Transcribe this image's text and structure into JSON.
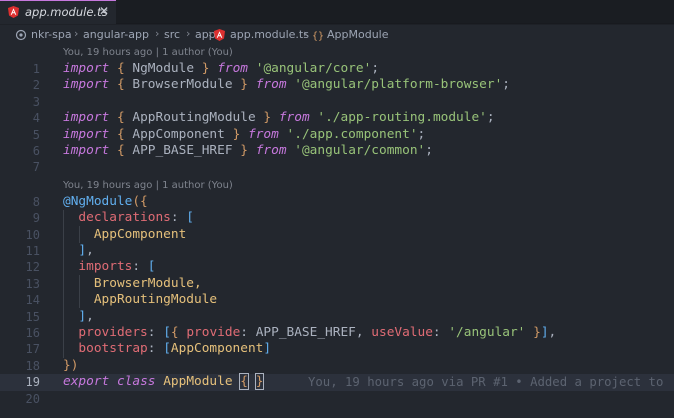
{
  "tab": {
    "filename": "app.module.ts",
    "close": "✕"
  },
  "breadcrumb": {
    "items": [
      "nkr-spa",
      "angular-app",
      "src",
      "app",
      "app.module.ts",
      "AppModule"
    ],
    "separator": "›"
  },
  "blame_annotations": [
    "You, 19 hours ago | 1 author (You)",
    "You, 19 hours ago | 1 author (You)"
  ],
  "line_numbers": [
    "1",
    "2",
    "3",
    "4",
    "5",
    "6",
    "7",
    "8",
    "9",
    "10",
    "11",
    "12",
    "13",
    "14",
    "15",
    "16",
    "17",
    "18",
    "19",
    "20"
  ],
  "code": {
    "l1": {
      "kw": "import",
      "open": "{",
      "name": "NgModule",
      "close": "}",
      "from": "from",
      "str": "'@angular/core'",
      "end": ";"
    },
    "l2": {
      "kw": "import",
      "open": "{",
      "name": "BrowserModule",
      "close": "}",
      "from": "from",
      "str": "'@angular/platform-browser'",
      "end": ";"
    },
    "l4": {
      "kw": "import",
      "open": "{",
      "name": "AppRoutingModule",
      "close": "}",
      "from": "from",
      "str": "'./app-routing.module'",
      "end": ";"
    },
    "l5": {
      "kw": "import",
      "open": "{",
      "name": "AppComponent",
      "close": "}",
      "from": "from",
      "str": "'./app.component'",
      "end": ";"
    },
    "l6": {
      "kw": "import",
      "open": "{",
      "name": "APP_BASE_HREF",
      "close": "}",
      "from": "from",
      "str": "'@angular/common'",
      "end": ";"
    },
    "l8": {
      "decorator": "@NgModule",
      "open": "({"
    },
    "l9": {
      "prop": "declarations",
      "colon": ": ",
      "open": "["
    },
    "l10": {
      "value": "AppComponent"
    },
    "l11": {
      "close": "]",
      "comma": ","
    },
    "l12": {
      "prop": "imports",
      "colon": ": ",
      "open": "["
    },
    "l13": {
      "value": "BrowserModule,"
    },
    "l14": {
      "value": "AppRoutingModule"
    },
    "l15": {
      "close": "]",
      "comma": ","
    },
    "l16": {
      "prop": "providers",
      "colon": ": ",
      "open1": "[",
      "open2": "{",
      "key1": "provide",
      "colon1": ": ",
      "val1": "APP_BASE_HREF, ",
      "key2": "useValue",
      "colon2": ": ",
      "str": "'/angular'",
      "close2": " }",
      "close1": "]",
      "end": ","
    },
    "l17": {
      "prop": "bootstrap",
      "colon": ": ",
      "open": "[",
      "value": "AppComponent",
      "close": "]"
    },
    "l18": {
      "close": "})"
    },
    "l19": {
      "kw1": "export",
      "kw2": "class",
      "name": "AppModule",
      "open": "{",
      "close": "}"
    },
    "inline_blame": "You, 19 hours ago via PR #1 • Added a project to"
  },
  "colors": {
    "background": "#23272e",
    "keyword": "#c678dd",
    "string": "#98c379",
    "property": "#e06c75",
    "decorator": "#61afef",
    "bracket": "#d19a66",
    "class": "#e5c07b",
    "angular_icon": "#dd3030"
  },
  "icons": [
    "angular-icon",
    "close-icon",
    "branch-icon",
    "braces-icon"
  ]
}
